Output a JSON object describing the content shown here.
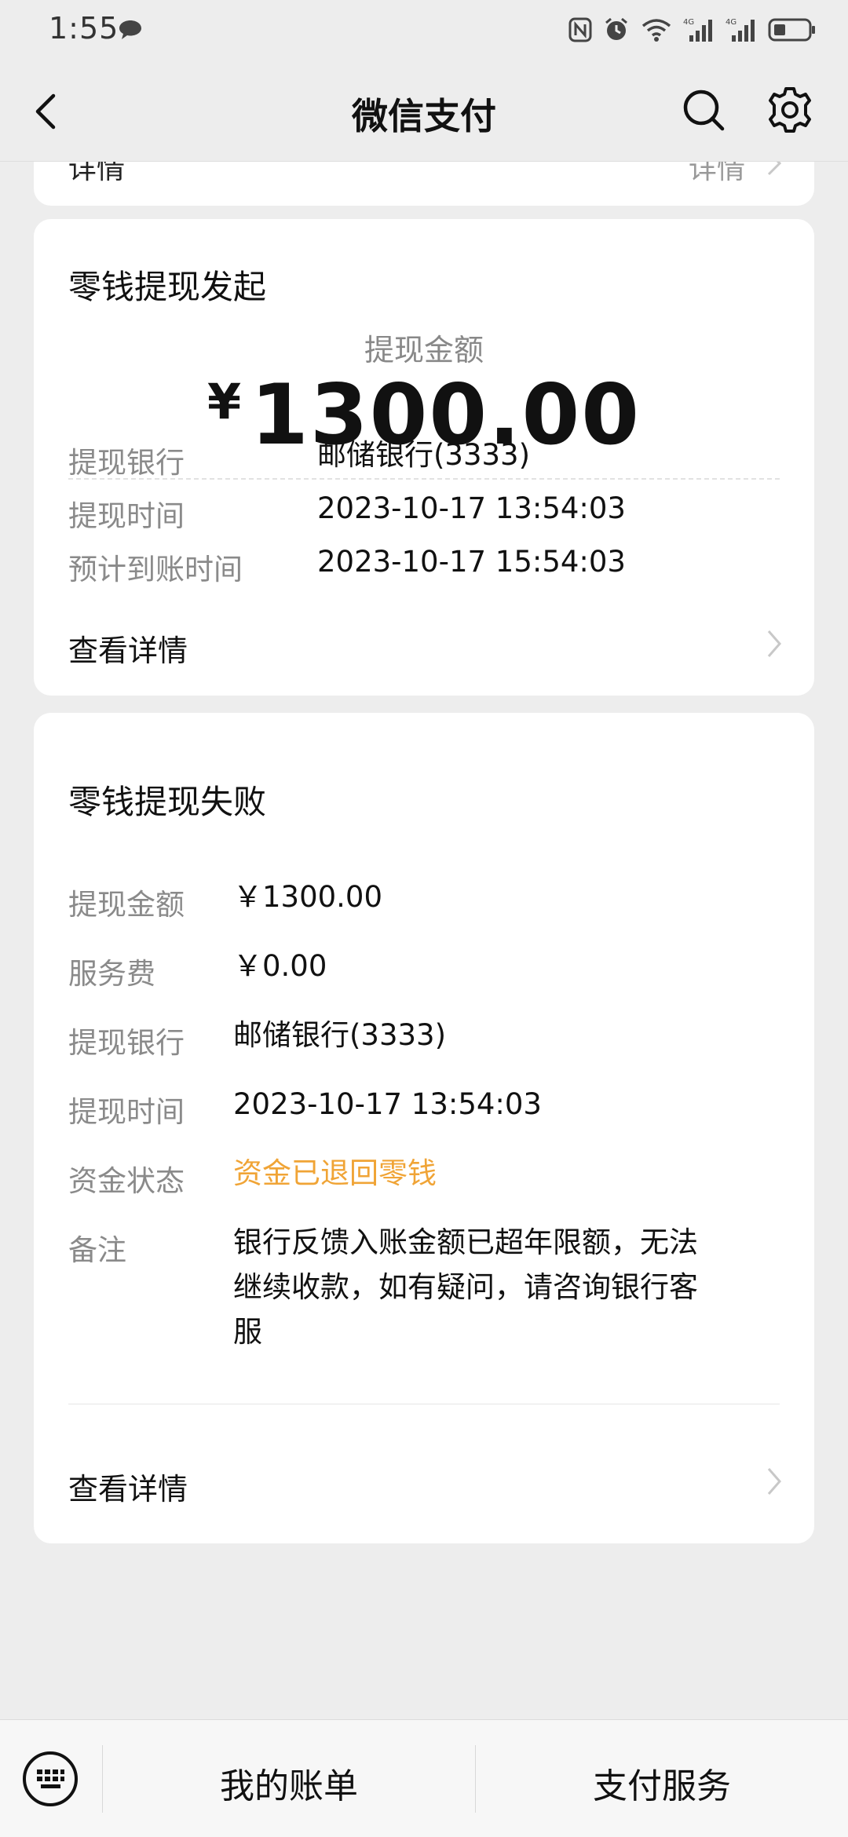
{
  "status_bar": {
    "time": "1:55"
  },
  "nav": {
    "title": "微信支付"
  },
  "partial_card": {
    "left_text": "详情",
    "right_text": "详情"
  },
  "card1": {
    "title": "零钱提现发起",
    "amount_label": "提现金额",
    "amount_currency": "¥",
    "amount_number": "1300.00",
    "rows": [
      {
        "label": "提现银行",
        "value": "邮储银行(3333)"
      },
      {
        "label": "提现时间",
        "value": "2023-10-17 13:54:03"
      },
      {
        "label": "预计到账时间",
        "value": "2023-10-17 15:54:03"
      }
    ],
    "detail_link": "查看详情"
  },
  "card2": {
    "title": "零钱提现失败",
    "rows": [
      {
        "label": "提现金额",
        "value": "￥1300.00"
      },
      {
        "label": "服务费",
        "value": "￥0.00"
      },
      {
        "label": "提现银行",
        "value": "邮储银行(3333)"
      },
      {
        "label": "提现时间",
        "value": "2023-10-17 13:54:03"
      },
      {
        "label": "资金状态",
        "value": "资金已退回零钱"
      },
      {
        "label": "备注",
        "value_line1": "银行反馈入账金额已超年限额，无法",
        "value_line2": "继续收款，如有疑问，请咨询银行客",
        "value_line3": "服"
      }
    ],
    "status_color": "#f0a436",
    "detail_link": "查看详情"
  },
  "bottom_bar": {
    "tab1": "我的账单",
    "tab2": "支付服务"
  }
}
